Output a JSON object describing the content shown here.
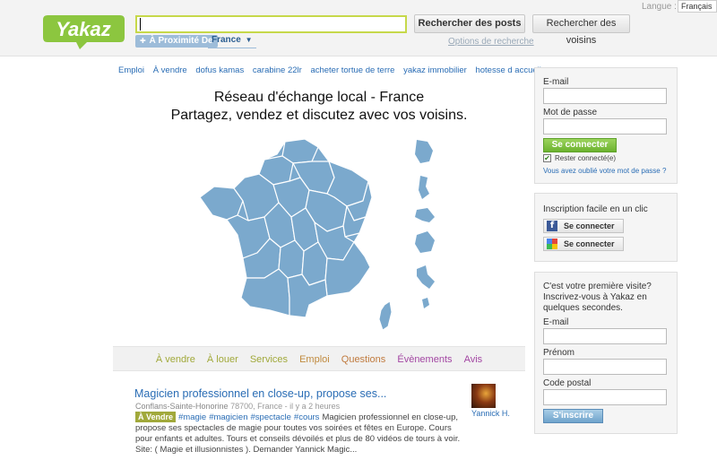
{
  "header": {
    "logo_text": "Yakaz",
    "search_value": "",
    "near_label": "À Proximité De",
    "country": "France",
    "search_posts_button": "Rechercher des posts",
    "search_neighbors_button": "Rechercher des voisins",
    "search_options_link": "Options de recherche",
    "language_label": "Langue :",
    "language_value": "Français"
  },
  "tag_links": [
    "Emploi",
    "À vendre",
    "dofus kamas",
    "carabine 22lr",
    "acheter tortue de terre",
    "yakaz immobilier",
    "hotesse d accueil"
  ],
  "headline": {
    "line1": "Réseau d'échange local - France",
    "line2": "Partagez, vendez et discutez avec vos voisins."
  },
  "map": {
    "main_fill": "#7ba9cd",
    "border_color": "#ffffff"
  },
  "categories": [
    {
      "label": "À vendre",
      "color": "#a1a93b"
    },
    {
      "label": "À louer",
      "color": "#a1a93b"
    },
    {
      "label": "Services",
      "color": "#a1a93b"
    },
    {
      "label": "Emploi",
      "color": "#c08a3e"
    },
    {
      "label": "Questions",
      "color": "#c07a3e"
    },
    {
      "label": "Évènements",
      "color": "#a347a3"
    },
    {
      "label": "Avis",
      "color": "#a347a3"
    }
  ],
  "post": {
    "title": "Magicien professionnel en close-up, propose ses...",
    "location": "Conflans-Sainte-Honorine",
    "postal_country": "78700, France",
    "time": "il y a 2 heures",
    "badge": "À Vendre",
    "hashtags": [
      "#magie",
      "#magicien",
      "#spectacle",
      "#cours"
    ],
    "body": "Magicien professionnel en close-up, propose ses spectacles de magie pour toutes vos soirées et fêtes en Europe. Cours pour enfants et adultes. Tours et conseils dévoilés et plus de 80 vidéos de tours à voir. Site: ( Magie et illusionnistes ). Demander Yannick Magic...",
    "author": "Yannick H."
  },
  "login": {
    "email_label": "E-mail",
    "password_label": "Mot de passe",
    "login_button": "Se connecter",
    "remember_label": "Rester connecté(e)",
    "remember_checked": true,
    "forgot_link": "Vous avez oublié votre mot de passe ?"
  },
  "social": {
    "intro": "Inscription facile en un clic",
    "facebook_button": "Se connecter",
    "google_button": "Se connecter"
  },
  "signup": {
    "intro": "C'est votre première visite? Inscrivez-vous à Yakaz en quelques secondes.",
    "email_label": "E-mail",
    "firstname_label": "Prénom",
    "postal_label": "Code postal",
    "signup_button": "S'inscrire"
  }
}
